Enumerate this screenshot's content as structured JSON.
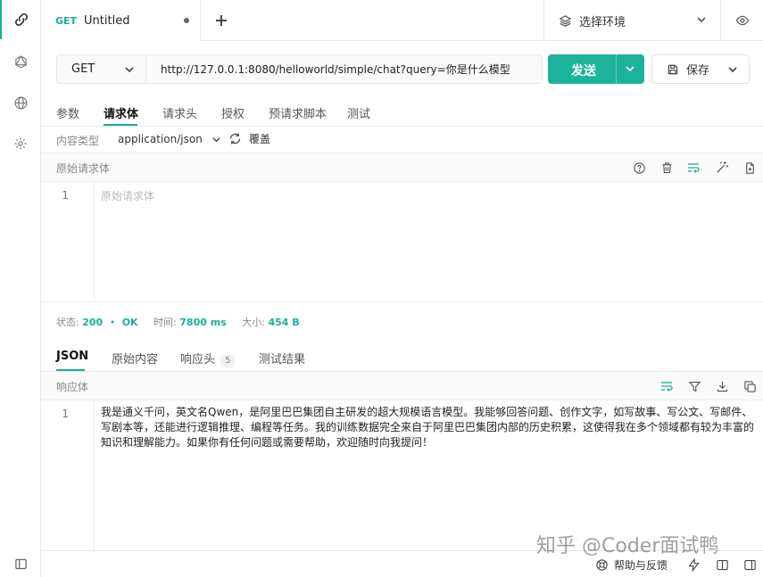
{
  "tab": {
    "method": "GET",
    "title": "Untitled"
  },
  "env": {
    "label": "选择环境"
  },
  "request": {
    "method": "GET",
    "url": "http://127.0.0.1:8080/helloworld/simple/chat?query=你是什么模型",
    "send_label": "发送",
    "save_label": "保存"
  },
  "request_tabs": [
    "参数",
    "请求体",
    "请求头",
    "授权",
    "预请求脚本",
    "测试"
  ],
  "content_type": {
    "label": "内容类型",
    "value": "application/json",
    "override_label": "覆盖"
  },
  "raw_body": {
    "title": "原始请求体",
    "line_number": "1",
    "placeholder": "原始请求体"
  },
  "status_bar": {
    "status_label": "状态:",
    "status_code": "200",
    "status_text": "OK",
    "time_label": "时间:",
    "time_value": "7800 ms",
    "size_label": "大小:",
    "size_value": "454 B"
  },
  "response_tabs": [
    "JSON",
    "原始内容",
    "响应头",
    "测试结果"
  ],
  "response_headers_count": "5",
  "response_body": {
    "title": "响应体",
    "line_number": "1",
    "text": "我是通义千问，英文名Qwen，是阿里巴巴集团自主研发的超大规模语言模型。我能够回答问题、创作文字，如写故事、写公文、写邮件、写剧本等，还能进行逻辑推理、编程等任务。我的训练数据完全来自于阿里巴巴集团内部的历史积累，这使得我在多个领域都有较为丰富的知识和理解能力。如果你有任何问题或需要帮助，欢迎随时向我提问！"
  },
  "footer": {
    "help_label": "帮助与反馈"
  },
  "watermark": "知乎 @Coder面试鸭",
  "colors": {
    "accent": "#1bb39b"
  }
}
